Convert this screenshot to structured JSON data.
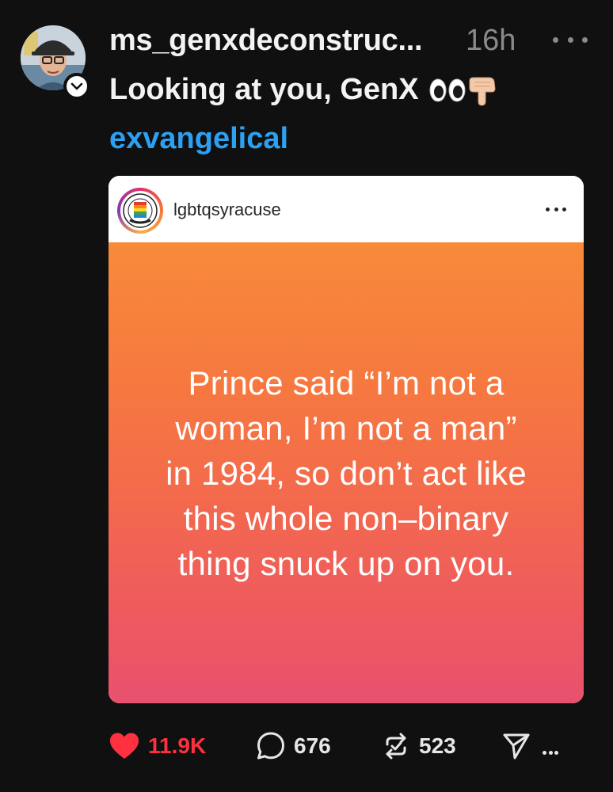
{
  "post": {
    "username": "ms_genxdeconstruc...",
    "timestamp": "16h",
    "caption": "Looking at you, GenX",
    "caption_emojis": [
      "eyes-emoji",
      "pointing-down-hand-emoji"
    ],
    "topic_tag": "exvangelical",
    "avatar_icon": "profile-photo-person-with-cap-and-glasses",
    "follow_badge_icon": "chevron-down-icon"
  },
  "embed": {
    "account": "lgbtqsyracuse",
    "account_avatar_icon": "rainbow-fist-logo",
    "quote_lines": [
      "Prince said “I’m not a",
      "woman, I’m not a man”",
      "in 1984, so don’t act like",
      "this whole non–binary",
      "thing snuck up on you."
    ],
    "background_colors": [
      "#f88a3a",
      "#e8516e"
    ]
  },
  "actions": {
    "likes": "11.9K",
    "replies": "676",
    "reposts": "523",
    "like_color": "#ff3040",
    "icons": [
      "heart-icon",
      "comment-icon",
      "repost-icon",
      "send-icon",
      "more-icon"
    ]
  },
  "colors": {
    "background": "#101010",
    "link": "#2da0f2",
    "muted": "#8a8a8a"
  }
}
